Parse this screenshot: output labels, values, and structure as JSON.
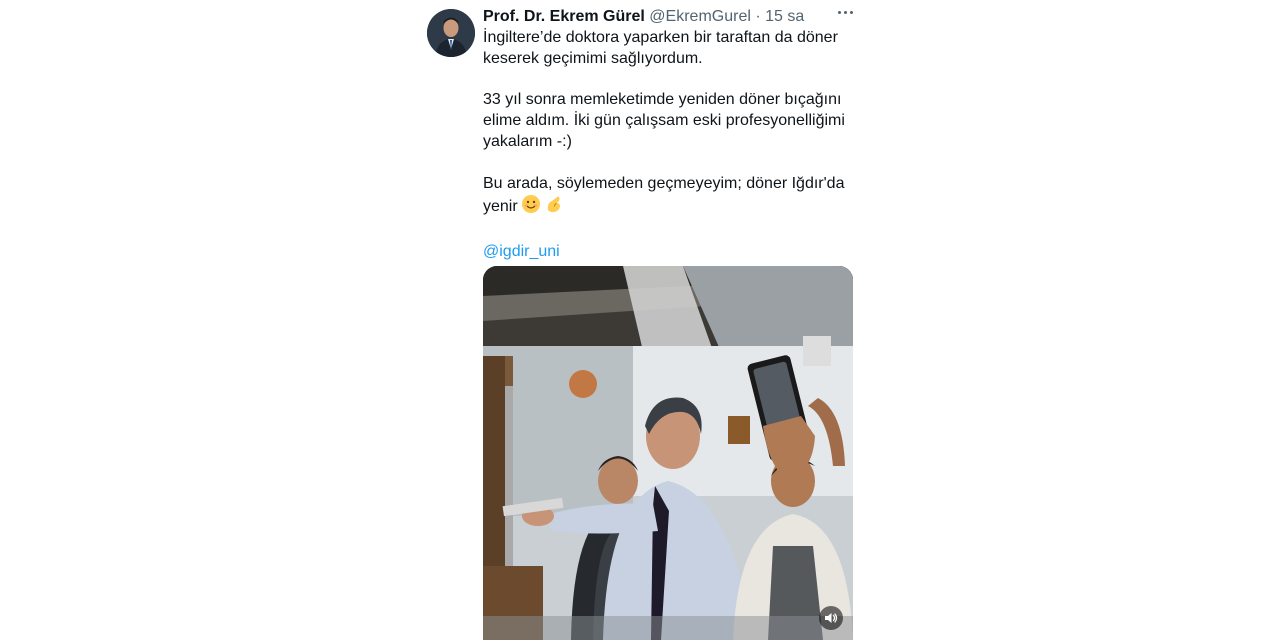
{
  "tweet": {
    "author_name": "Prof. Dr. Ekrem Gürel",
    "author_handle": "@EkremGurel",
    "separator": "·",
    "timestamp": "15 sa",
    "paragraphs": [
      "İngiltere’de doktora yaparken bir taraftan da döner\nkeserek geçimimi sağlıyordum.",
      "33 yıl sonra memleketimde yeniden döner bıçağını\nelime aldım. İki gün çalışsam eski profesyonelliğimi\nyakalarım -:)",
      "Bu arada, söylemeden geçmeyeyim; döner Iğdır'da\nyenir"
    ],
    "emojis": [
      "smiling-face-emoji",
      "pinching-hand-emoji"
    ],
    "mention": "@igdir_uni",
    "icons": {
      "more": "more-horizontal-icon",
      "volume": "volume-icon"
    },
    "colors": {
      "link": "#1d9bf0",
      "secondary_text": "#536471",
      "primary_text": "#0f1419"
    }
  }
}
